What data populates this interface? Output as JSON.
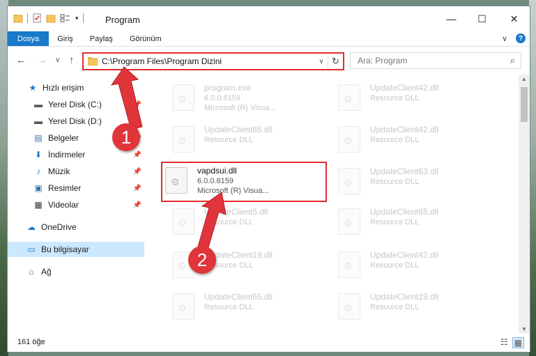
{
  "titlebar": {
    "title": "Program",
    "minimize": "—",
    "maximize": "☐",
    "close": "✕"
  },
  "ribbon": {
    "tabs": [
      "Dosya",
      "Giriş",
      "Paylaş",
      "Görünüm"
    ],
    "expand": "∨",
    "help": "?"
  },
  "address": {
    "path": "C:\\Program Files\\Program Dizini",
    "dropdown": "∨",
    "refresh": "↻"
  },
  "search": {
    "placeholder": "Ara: Program",
    "icon": "search-icon"
  },
  "nav": {
    "back": "←",
    "forward": "→",
    "recent": "∨",
    "up": "↑",
    "items": [
      {
        "label": "Hızlı erişim",
        "icon": "star-icon",
        "glyph": "★"
      },
      {
        "label": "Yerel Disk (C:)",
        "icon": "drive-icon",
        "glyph": "▬"
      },
      {
        "label": "Yerel Disk (D:)",
        "icon": "drive-icon",
        "glyph": "▬"
      },
      {
        "label": "Belgeler",
        "icon": "documents-icon",
        "glyph": "▤"
      },
      {
        "label": "İndirmeler",
        "icon": "downloads-icon",
        "glyph": "⬇"
      },
      {
        "label": "Müzik",
        "icon": "music-icon",
        "glyph": "♪"
      },
      {
        "label": "Resimler",
        "icon": "pictures-icon",
        "glyph": "▣"
      },
      {
        "label": "Videolar",
        "icon": "videos-icon",
        "glyph": "▦"
      },
      {
        "label": "OneDrive",
        "icon": "cloud-icon",
        "glyph": "☁"
      },
      {
        "label": "Bu bilgisayar",
        "icon": "computer-icon",
        "glyph": "▭"
      },
      {
        "label": "Ağ",
        "icon": "network-icon",
        "glyph": "⌂"
      }
    ]
  },
  "files": {
    "left": [
      {
        "name": "program.exe",
        "line2": "6.0.0.8159",
        "line3": "Microsoft (R) Visua..."
      },
      {
        "name": "UpdateClient65.dll",
        "line2": "Resource DLL",
        "line3": ""
      },
      {
        "name": "vapdsui.dll",
        "line2": "6.0.0.8159",
        "line3": "Microsoft (R) Visua..."
      },
      {
        "name": "UpdateClient5.dll",
        "line2": "Resource DLL",
        "line3": ""
      },
      {
        "name": "UpdateClient19.dll",
        "line2": "Resource DLL",
        "line3": ""
      },
      {
        "name": "UpdateClient65.dll",
        "line2": "Resource DLL",
        "line3": ""
      }
    ],
    "right": [
      {
        "name": "UpdateClient42.dll",
        "line2": "Resource DLL"
      },
      {
        "name": "UpdateClient42.dll",
        "line2": "Resource DLL"
      },
      {
        "name": "UpdateClient63.dll",
        "line2": "Resource DLL"
      },
      {
        "name": "UpdateClient65.dll",
        "line2": "Resource DLL"
      },
      {
        "name": "UpdateClient42.dll",
        "line2": "Resource DLL"
      },
      {
        "name": "UpdateClient19.dll",
        "line2": "Resource DLL"
      }
    ]
  },
  "status": {
    "count": "161 öğe"
  },
  "annotations": {
    "step1": "1",
    "step2": "2",
    "color": "#e0353a"
  }
}
